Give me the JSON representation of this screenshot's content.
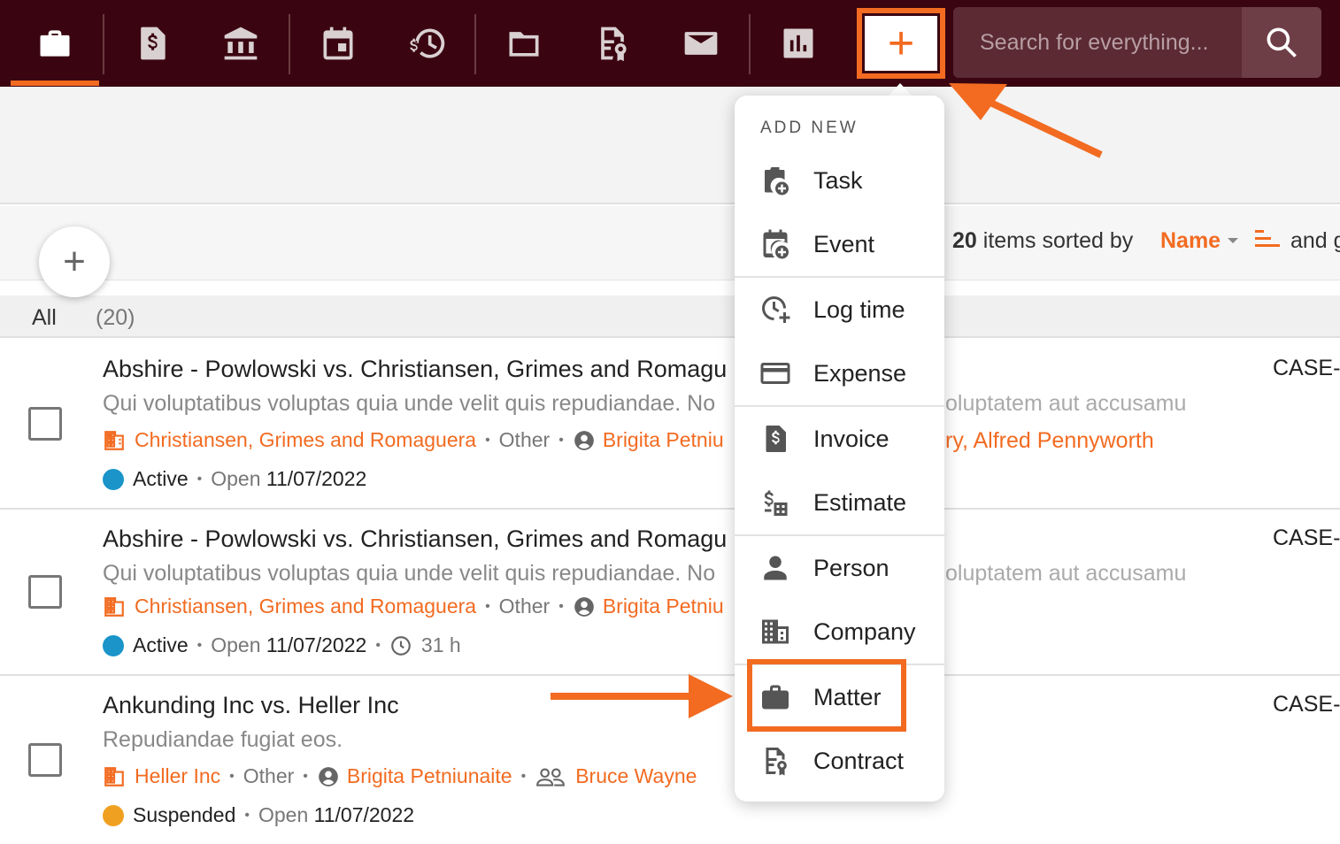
{
  "nav": {
    "items": [
      {
        "icon": "briefcase-icon"
      },
      {
        "icon": "invoice-icon"
      },
      {
        "icon": "bank-icon"
      },
      {
        "icon": "calendar-icon"
      },
      {
        "icon": "time-money-icon"
      },
      {
        "icon": "folder-icon"
      },
      {
        "icon": "contract-icon"
      },
      {
        "icon": "mail-icon"
      },
      {
        "icon": "reports-icon"
      }
    ],
    "active_index": 0,
    "add_label": "+",
    "search_placeholder": "Search for everything..."
  },
  "toolbar": {
    "count": "20",
    "sorted_by_text": "items sorted by",
    "sort_field": "Name",
    "and_text": "and g"
  },
  "fab_label": "+",
  "filter": {
    "label": "All",
    "count": "(20)"
  },
  "rows": [
    {
      "title": "Abshire - Powlowski vs. Christiansen, Grimes and Romagu",
      "description": "Qui voluptatibus voluptas quia unde velit quis repudiandae. No",
      "description_right": "oluptatem aut accusamu",
      "company": "Christiansen, Grimes and Romaguera",
      "type": "Other",
      "person": "Brigita Petniu",
      "people_right": "ry, Alfred Pennyworth",
      "status": "Active",
      "status_color": "#1a94c9",
      "open_label": "Open",
      "open_date": "11/07/2022",
      "hours": "",
      "case_id": "CASE-"
    },
    {
      "title": "Abshire - Powlowski vs. Christiansen, Grimes and Romagu",
      "description": "Qui voluptatibus voluptas quia unde velit quis repudiandae. No",
      "description_right": "oluptatem aut accusamu",
      "company": "Christiansen, Grimes and Romaguera",
      "type": "Other",
      "person": "Brigita Petniu",
      "status": "Active",
      "status_color": "#1a94c9",
      "open_label": "Open",
      "open_date": "11/07/2022",
      "hours": "31 h",
      "case_id": "CASE-"
    },
    {
      "title": "Ankunding Inc vs. Heller Inc",
      "description": "Repudiandae fugiat eos.",
      "company": "Heller Inc",
      "type": "Other",
      "person": "Brigita Petniunaite",
      "group": "Bruce Wayne",
      "status": "Suspended",
      "status_color": "#f0a020",
      "open_label": "Open",
      "open_date": "11/07/2022",
      "case_id": "CASE-"
    }
  ],
  "menu": {
    "header": "ADD NEW",
    "items": [
      {
        "label": "Task",
        "icon": "task-add-icon"
      },
      {
        "label": "Event",
        "icon": "event-add-icon"
      },
      {
        "label": "Log time",
        "icon": "log-time-icon"
      },
      {
        "label": "Expense",
        "icon": "credit-card-icon"
      },
      {
        "label": "Invoice",
        "icon": "invoice-icon"
      },
      {
        "label": "Estimate",
        "icon": "estimate-icon"
      },
      {
        "label": "Person",
        "icon": "person-icon"
      },
      {
        "label": "Company",
        "icon": "building-icon"
      },
      {
        "label": "Matter",
        "icon": "briefcase-icon"
      },
      {
        "label": "Contract",
        "icon": "contract-icon"
      }
    ]
  },
  "colors": {
    "accent": "#f26b21",
    "topbar": "#3a0510"
  }
}
